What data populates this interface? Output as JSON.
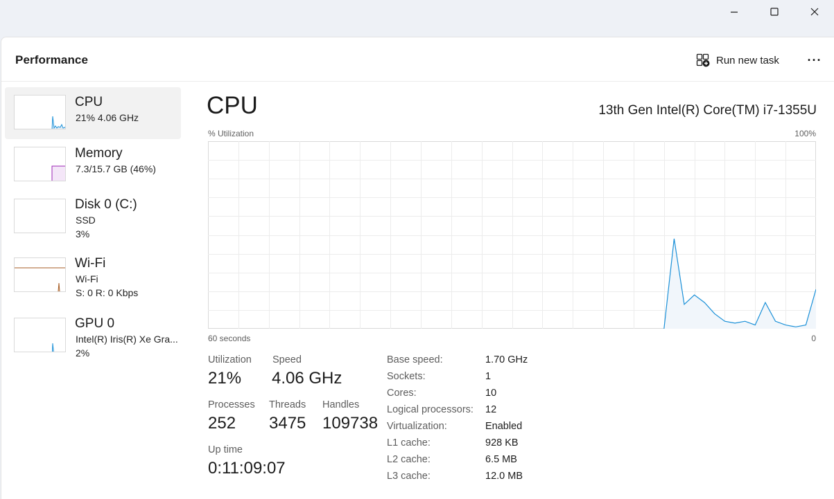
{
  "window": {
    "minimize": "minimize-icon",
    "maximize": "maximize-icon",
    "close": "close-icon"
  },
  "header": {
    "title": "Performance",
    "run_task_label": "Run new task",
    "run_task_icon": "run-task-icon",
    "more_icon": "more-icon",
    "more_glyph": "···"
  },
  "sidebar": {
    "items": [
      {
        "name": "CPU",
        "line1": "21%  4.06 GHz",
        "line2": "",
        "color": "#1a90d8"
      },
      {
        "name": "Memory",
        "line1": "7.3/15.7 GB (46%)",
        "line2": "",
        "color": "#9b26b6"
      },
      {
        "name": "Disk 0 (C:)",
        "line1": "SSD",
        "line2": "3%",
        "color": "#4ca64c"
      },
      {
        "name": "Wi-Fi",
        "line1": "Wi-Fi",
        "line2": "S: 0  R: 0 Kbps",
        "color": "#a75d25"
      },
      {
        "name": "GPU 0",
        "line1": "Intel(R) Iris(R) Xe Gra...",
        "line2": "2%",
        "color": "#1a90d8"
      }
    ]
  },
  "main": {
    "title": "CPU",
    "model": "13th Gen Intel(R) Core(TM) i7-1355U",
    "y_label": "% Utilization",
    "y_max_label": "100%",
    "x_left_label": "60 seconds",
    "x_right_label": "0",
    "stats": {
      "utilization_label": "Utilization",
      "utilization": "21%",
      "speed_label": "Speed",
      "speed": "4.06 GHz",
      "processes_label": "Processes",
      "processes": "252",
      "threads_label": "Threads",
      "threads": "3475",
      "handles_label": "Handles",
      "handles": "109738",
      "uptime_label": "Up time",
      "uptime": "0:11:09:07"
    },
    "specs": [
      {
        "label": "Base speed:",
        "value": "1.70 GHz"
      },
      {
        "label": "Sockets:",
        "value": "1"
      },
      {
        "label": "Cores:",
        "value": "10"
      },
      {
        "label": "Logical processors:",
        "value": "12"
      },
      {
        "label": "Virtualization:",
        "value": "Enabled"
      },
      {
        "label": "L1 cache:",
        "value": "928 KB"
      },
      {
        "label": "L2 cache:",
        "value": "6.5 MB"
      },
      {
        "label": "L3 cache:",
        "value": "12.0 MB"
      }
    ]
  },
  "chart_data": {
    "type": "area",
    "ylabel": "% Utilization",
    "ylim": [
      0,
      100
    ],
    "x_range_label": [
      "60 seconds",
      "0"
    ],
    "grid": true,
    "color": "#1a90d8",
    "x": [
      15,
      14,
      13,
      12,
      11,
      10,
      9,
      8,
      7,
      6,
      5,
      4,
      3,
      2,
      1,
      0
    ],
    "values": [
      0,
      48,
      13,
      18,
      14,
      8,
      4,
      3,
      4,
      2,
      14,
      4,
      2,
      1,
      2,
      21
    ]
  }
}
